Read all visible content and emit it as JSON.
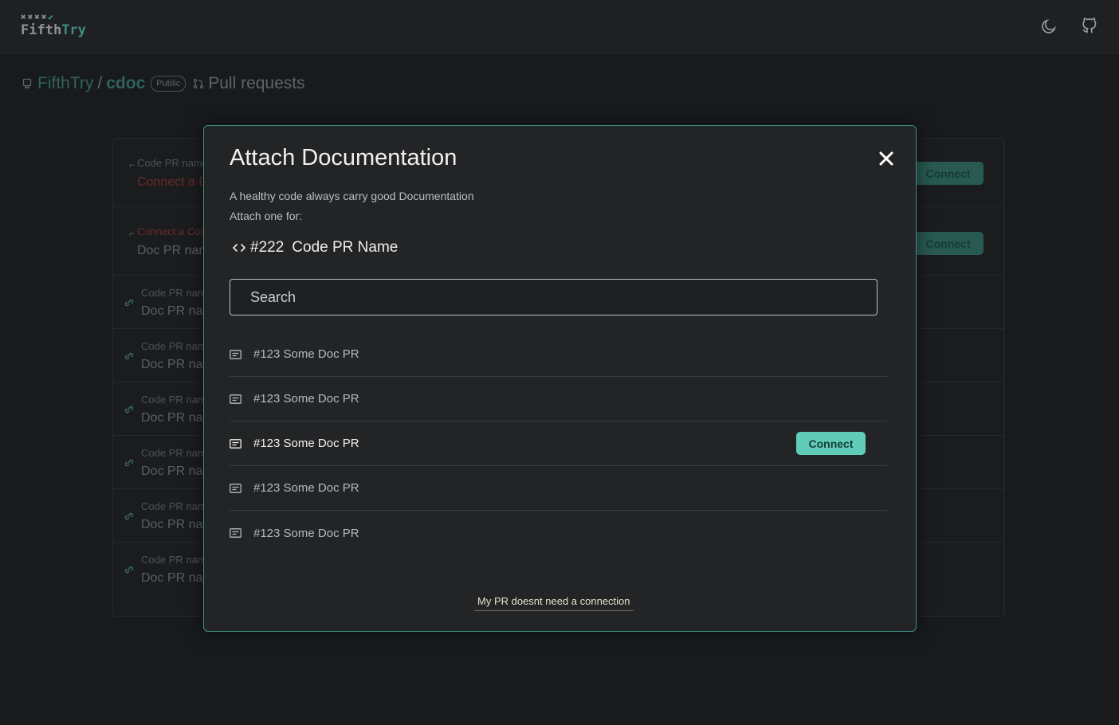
{
  "header": {
    "logo_marks": "✖✖✖✖",
    "logo_check": "✔",
    "logo_word_a": "Fifth",
    "logo_word_b": "Try",
    "theme_icon": "moon-icon",
    "github_icon": "github-icon"
  },
  "breadcrumb": {
    "org": "FifthTry",
    "separator": "/",
    "repo": "cdoc",
    "visibility": "Public",
    "section": "Pull requests"
  },
  "background_rows": [
    {
      "line1": "Code PR name",
      "line2": "Connect a D",
      "button": "Connect"
    },
    {
      "line1": "Connect a Cod",
      "line2": "Doc PR nam",
      "button": "Connect"
    },
    {
      "line1": "Code PR nam",
      "line2": "Doc PR nar"
    },
    {
      "line1": "Code PR nam",
      "line2": "Doc PR nar"
    },
    {
      "line1": "Code PR nam",
      "line2": "Doc PR nar"
    },
    {
      "line1": "Code PR nam",
      "line2": "Doc PR nar"
    },
    {
      "line1": "Code PR nam",
      "line2": "Doc PR nar"
    },
    {
      "line1": "Code PR nam",
      "line2": "Doc PR nar"
    }
  ],
  "modal": {
    "title": "Attach Documentation",
    "subtitle_line1": "A healthy code always carry good Documentation",
    "subtitle_line2": "Attach one for:",
    "target_number": "#222",
    "target_name": "Code PR Name",
    "search_placeholder": "Search",
    "items": [
      {
        "label": "#123 Some Doc PR"
      },
      {
        "label": "#123 Some Doc PR"
      },
      {
        "label": "#123 Some Doc PR",
        "button": "Connect"
      },
      {
        "label": "#123 Some Doc PR"
      },
      {
        "label": "#123 Some Doc PR"
      }
    ],
    "skip_link": "My PR doesnt need a connection"
  },
  "colors": {
    "accent": "#61cdb9",
    "modal_border": "#3f8c82",
    "background": "#181a1c"
  }
}
